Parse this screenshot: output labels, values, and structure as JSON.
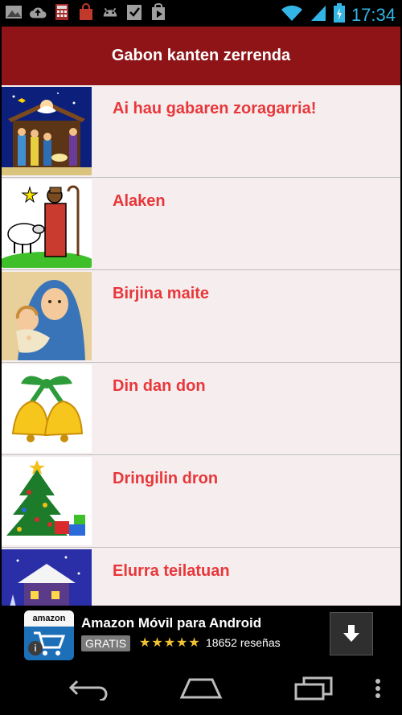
{
  "status_bar": {
    "time": "17:34",
    "left_icons": [
      "gallery-icon",
      "upload-icon",
      "calculator-icon",
      "shopping-bag-icon",
      "android-icon",
      "checklist-icon",
      "play-store-icon"
    ],
    "right_icons": [
      "wifi-icon",
      "signal-icon",
      "battery-icon"
    ]
  },
  "header": {
    "title": "Gabon kanten zerrenda"
  },
  "songs": [
    {
      "title": "Ai hau gabaren zoragarria!",
      "image": "nativity-scene-icon"
    },
    {
      "title": "Alaken",
      "image": "shepherd-sheep-icon"
    },
    {
      "title": "Birjina maite",
      "image": "virgin-mary-icon"
    },
    {
      "title": "Din dan don",
      "image": "christmas-bells-icon"
    },
    {
      "title": "Dringilin dron",
      "image": "christmas-tree-icon"
    },
    {
      "title": "Elurra teilatuan",
      "image": "snowy-house-icon"
    }
  ],
  "ad": {
    "logo_text": "amazon",
    "title": "Amazon Móvil para Android",
    "price_badge": "GRATIS",
    "stars": "★★★★★",
    "rating": 4.5,
    "reviews": "18652 reseñas"
  },
  "colors": {
    "header_bg": "#8e1418",
    "title_text": "#e8373b",
    "row_bg": "#f6eeee",
    "status_accent": "#33b5e5"
  }
}
